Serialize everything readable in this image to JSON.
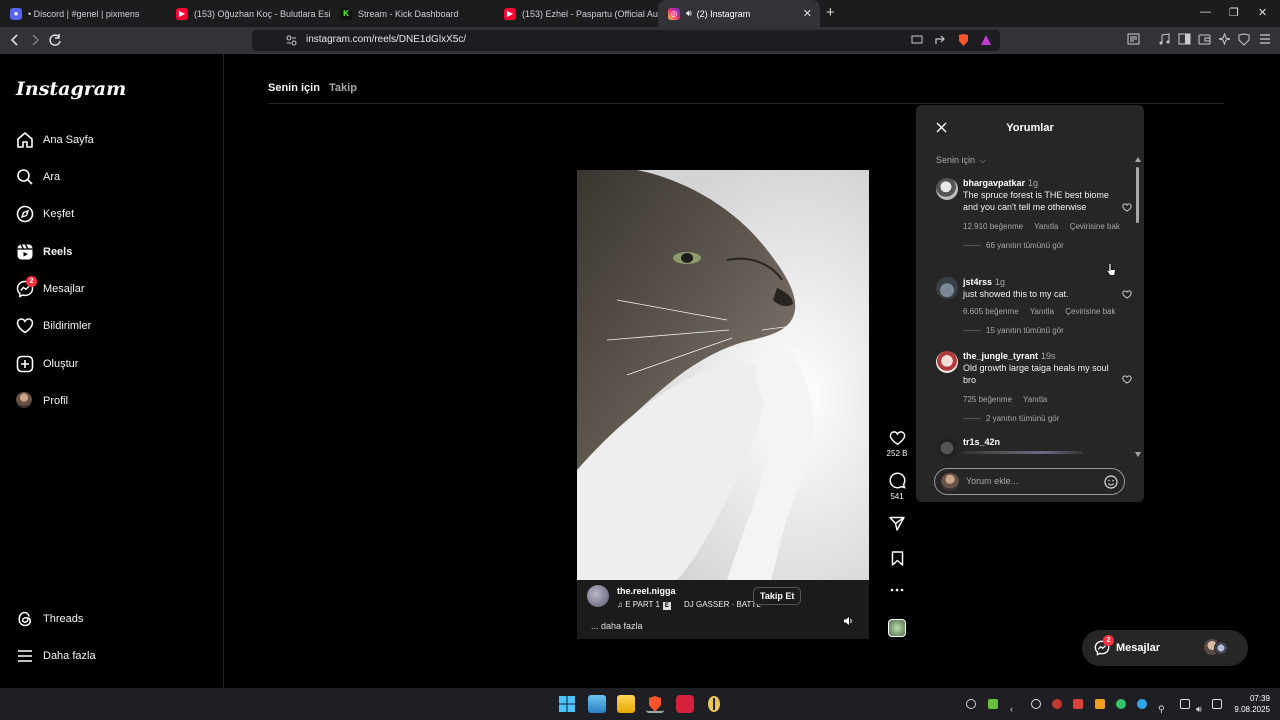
{
  "browser": {
    "tabs": [
      {
        "title": "• Discord | #genel | pixmens",
        "favicon": "discord-icon",
        "color": "#5865f2"
      },
      {
        "title": "(153) Oğuzhan Koç - Bulutlara Esir Ol",
        "favicon": "youtube-icon",
        "color": "#ff0033"
      },
      {
        "title": "Stream - Kick Dashboard",
        "favicon": "kick-icon",
        "color": "#53fc18"
      },
      {
        "title": "(153) Ezhel - Paspartu (Official Audio)",
        "favicon": "youtube-icon",
        "color": "#ff0033"
      },
      {
        "title": "(2) Instagram",
        "favicon": "instagram-icon",
        "color": "#e1306c"
      }
    ],
    "url": "instagram.com/reels/DNE1dGlxX5c/"
  },
  "instagram": {
    "logo": "Instagram",
    "nav": [
      {
        "label": "Ana Sayfa",
        "icon": "home-icon"
      },
      {
        "label": "Ara",
        "icon": "search-icon"
      },
      {
        "label": "Keşfet",
        "icon": "explore-icon"
      },
      {
        "label": "Reels",
        "icon": "reels-icon"
      },
      {
        "label": "Mesajlar",
        "icon": "messenger-icon",
        "badge": "2"
      },
      {
        "label": "Bildirimler",
        "icon": "heart-icon"
      },
      {
        "label": "Oluştur",
        "icon": "create-icon"
      },
      {
        "label": "Profil",
        "icon": "avatar"
      }
    ],
    "nav_bottom": [
      {
        "label": "Threads",
        "icon": "threads-icon"
      },
      {
        "label": "Daha fazla",
        "icon": "menu-icon"
      }
    ],
    "feed_tabs": [
      "Senin için",
      "Takip"
    ],
    "reel": {
      "username": "the.reel.nigga",
      "audio": "E PART 1",
      "artist": "DJ GASSER · BATTL",
      "follow": "Takip Et",
      "more": "... daha fazla",
      "likes": "252 B",
      "comments": "541"
    },
    "comments_panel": {
      "title": "Yorumlar",
      "filter": "Senin için",
      "input_placeholder": "Yorum ekle...",
      "comments": [
        {
          "user": "bhargavpatkar",
          "time": "1g",
          "text": "The spruce forest is THE best biome and you can't tell me otherwise",
          "likes": "12.910 beğenme",
          "reply": "Yanıtla",
          "translate": "Çevirisine bak",
          "replies": "66 yanıtın tümünü gör"
        },
        {
          "user": "jst4rss",
          "time": "1g",
          "text": "just showed this to my cat.",
          "likes": "6.605 beğenme",
          "reply": "Yanıtla",
          "translate": "Çevirisine bak",
          "replies": "15 yanıtın tümünü gör"
        },
        {
          "user": "the_jungle_tyrant",
          "time": "19s",
          "text": "Old growth large taiga heals my soul bro",
          "likes": "725 beğenme",
          "reply": "Yanıtla",
          "replies": "2 yanıtın tümünü gör"
        },
        {
          "user": "tr1s_42n",
          "time": "",
          "text": ""
        }
      ]
    },
    "messages_pill": {
      "label": "Mesajlar",
      "badge": "2"
    }
  },
  "taskbar": {
    "time": "07:39",
    "date": "9.08.2025"
  }
}
